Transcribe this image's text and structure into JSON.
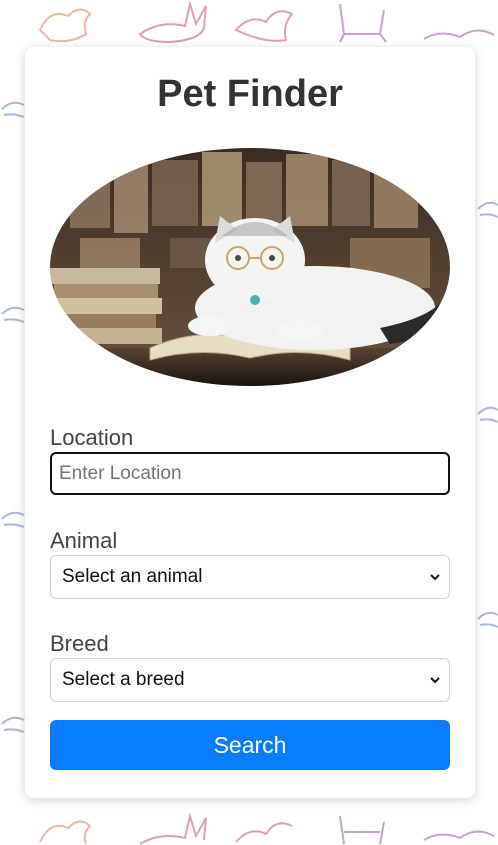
{
  "page": {
    "title": "Pet Finder"
  },
  "hero": {
    "alt": "Cat wearing glasses lying on an open book"
  },
  "form": {
    "location": {
      "label": "Location",
      "placeholder": "Enter Location",
      "value": ""
    },
    "animal": {
      "label": "Animal",
      "selected": "Select an animal"
    },
    "breed": {
      "label": "Breed",
      "selected": "Select a breed"
    },
    "search_label": "Search"
  },
  "colors": {
    "accent": "#0a7cff",
    "title": "#333333",
    "label": "#444444"
  },
  "icons": {
    "dropdown": "chevron-down-icon"
  }
}
